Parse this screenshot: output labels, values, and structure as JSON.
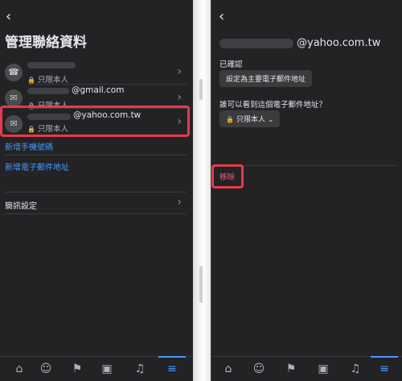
{
  "left": {
    "back_icon": "chevron-left-icon",
    "title": "管理聯絡資料",
    "rows": [
      {
        "icon": "phone-icon",
        "value": "",
        "privacy": "只限本人"
      },
      {
        "icon": "mail-icon",
        "value": "@gmail.com",
        "privacy": "只限本人"
      },
      {
        "icon": "mail-icon",
        "value": "@yahoo.com.tw",
        "privacy": "只限本人"
      }
    ],
    "add_phone": "新增手機號碼",
    "add_email": "新增電子郵件地址",
    "alerts_settings": "簡訊設定"
  },
  "right": {
    "back_icon": "chevron-left-icon",
    "email": "@yahoo.com.tw",
    "verified_label": "已確認",
    "set_primary_button": "設定為主要電子郵件地址",
    "visibility_question": "誰可以看到這個電子郵件地址？",
    "visibility_value": "只限本人",
    "remove_label": "移除"
  },
  "tabbar": {
    "tabs": [
      "home-icon",
      "groups-icon",
      "flag-icon",
      "gaming-icon",
      "bell-icon",
      "menu-icon"
    ],
    "active_index": 5
  },
  "colors": {
    "accent": "#4599ff",
    "highlight": "#e8394b",
    "background": "#232325"
  }
}
